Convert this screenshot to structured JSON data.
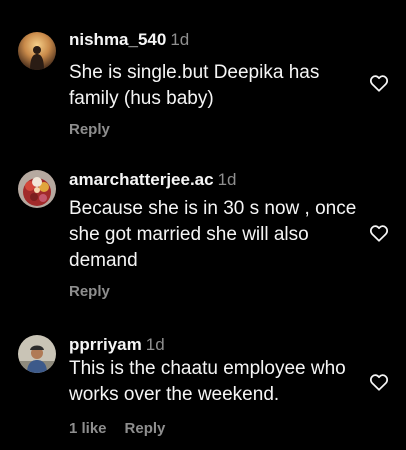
{
  "comments": [
    {
      "username": "nishma_540",
      "time": "1d",
      "text": "She is single.but Deepika has family (hus baby)",
      "likes": "",
      "reply": "Reply"
    },
    {
      "username": "amarchatterjee.ac",
      "time": "1d",
      "text": "Because she is in 30 s now , once she got married she will also demand",
      "likes": "",
      "reply": "Reply"
    },
    {
      "username": "pprriyam",
      "time": "1d",
      "text": "This is the chaatu employee who works over the weekend.",
      "likes": "1 like",
      "reply": "Reply"
    }
  ],
  "colors": {
    "background": "#000000",
    "primary_text": "#f5f5f5",
    "secondary_text": "#8e8e8e"
  }
}
